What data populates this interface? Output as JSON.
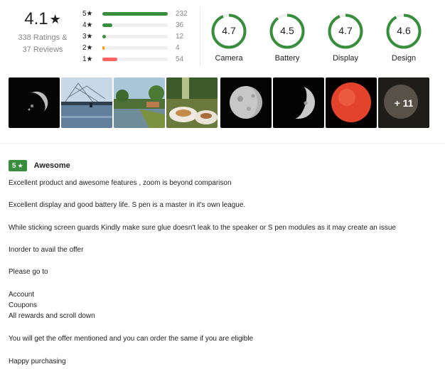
{
  "summary": {
    "rating": "4.1",
    "star_glyph": "★",
    "ratings_line1": "338 Ratings &",
    "ratings_line2": "37 Reviews"
  },
  "distribution": [
    {
      "label": "5★",
      "count": "232",
      "fraction": 1.0,
      "color": "#388e3c"
    },
    {
      "label": "4★",
      "count": "36",
      "fraction": 0.155,
      "color": "#388e3c"
    },
    {
      "label": "3★",
      "count": "12",
      "fraction": 0.052,
      "color": "#388e3c"
    },
    {
      "label": "2★",
      "count": "4",
      "fraction": 0.017,
      "color": "#ff9f00"
    },
    {
      "label": "1★",
      "count": "54",
      "fraction": 0.233,
      "color": "#ff6161"
    }
  ],
  "aspects": [
    {
      "name": "Camera",
      "value": "4.7",
      "fraction": 0.94
    },
    {
      "name": "Battery",
      "value": "4.5",
      "fraction": 0.9
    },
    {
      "name": "Display",
      "value": "4.7",
      "fraction": 0.94
    },
    {
      "name": "Design",
      "value": "4.6",
      "fraction": 0.92
    }
  ],
  "photos": {
    "items": [
      {
        "alt": "half-moon-photo"
      },
      {
        "alt": "fishing-net-lake-photo"
      },
      {
        "alt": "backwater-canal-photo"
      },
      {
        "alt": "food-plates-photo"
      },
      {
        "alt": "gibbous-moon-photo"
      },
      {
        "alt": "moon-crescent-photo"
      },
      {
        "alt": "red-sun-photo"
      },
      {
        "alt": "more-photos-tile"
      }
    ],
    "more_label": "+ 11"
  },
  "review": {
    "stars": "5",
    "star_glyph": "★",
    "title": "Awesome",
    "lines": [
      "Excellent product and awesome features , zoom is beyond comparison",
      "Excellent display and good battery life. S pen is a master in it's own league.",
      "While sticking screen guards Kindly make sure glue doesn't leak to the speaker or S pen modules as it may create an issue",
      "Inorder to avail the offer",
      "Please go to",
      "Account",
      "Coupons",
      "All rewards and scroll down",
      "You will get the offer mentioned and you can order the same if you are eligible",
      "Happy purchasing"
    ]
  },
  "colors": {
    "accent_green": "#388e3c",
    "ring_track": "#f0f0f0"
  }
}
